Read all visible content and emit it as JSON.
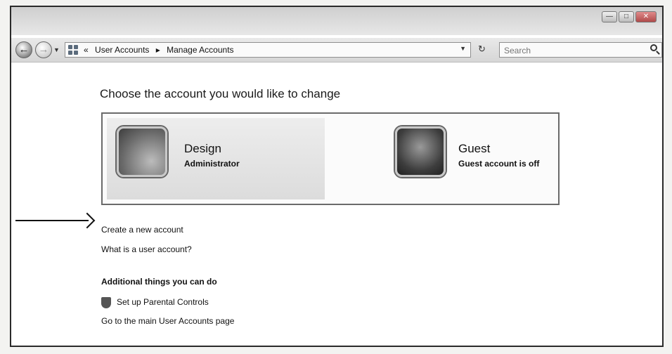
{
  "window": {
    "controls": [
      "minimize",
      "maximize",
      "close"
    ]
  },
  "nav": {
    "breadcrumb_prefix": "«",
    "breadcrumb": [
      "User Accounts",
      "Manage Accounts"
    ],
    "breadcrumb_sep": "▸",
    "search_placeholder": "Search"
  },
  "main": {
    "heading": "Choose the account you would like to change",
    "accounts": [
      {
        "name": "Design",
        "role": "Administrator",
        "icon": "user-picture-design"
      },
      {
        "name": "Guest",
        "role": "Guest account is off",
        "icon": "user-picture-guest"
      }
    ],
    "links": {
      "create": "Create a new account",
      "what_is": "What is a user account?"
    },
    "additional": {
      "title": "Additional things you can do",
      "parental": "Set up Parental Controls",
      "main_page": "Go to the main User Accounts page"
    }
  }
}
